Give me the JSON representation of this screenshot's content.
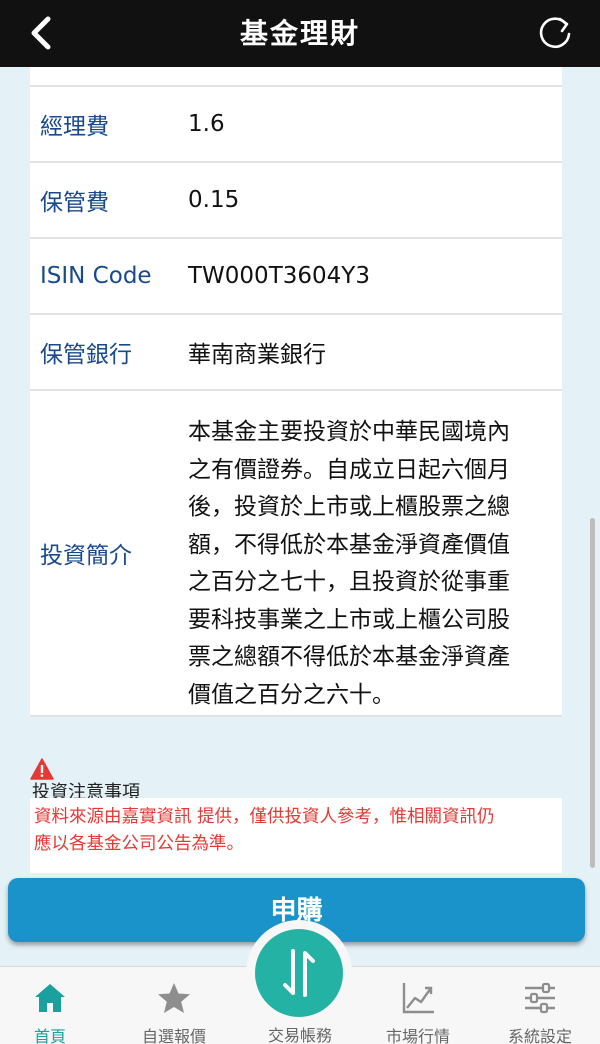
{
  "header": {
    "title": "基金理財"
  },
  "fund_info": [
    {
      "label": "經理費",
      "value": "1.6"
    },
    {
      "label": "保管費",
      "value": "0.15"
    },
    {
      "label": "ISIN Code",
      "value": "TW000T3604Y3"
    },
    {
      "label": "保管銀行",
      "value": "華南商業銀行"
    }
  ],
  "description": {
    "label": "投資簡介",
    "lines": [
      "本基金主要投資於中華民國境內",
      "之有價證券。自成立日起六個月",
      "後，投資於上市或上櫃股票之總",
      "額，不得低於本基金淨資產價值",
      "之百分之七十，且投資於從事重",
      "要科技事業之上市或上櫃公司股",
      "票之總額不得低於本基金淨資產",
      "價值之百分之六十。"
    ]
  },
  "notice": {
    "title": "投資注意事項",
    "line1": "資料來源由嘉實資訊 提供，僅供投資人參考，惟相關資訊仍",
    "line2": "應以各基金公司公告為準。"
  },
  "actions": {
    "subscribe_label": "申購"
  },
  "tabbar": {
    "home": "首頁",
    "watchlist": "自選報價",
    "trade": "交易帳務",
    "market": "市場行情",
    "settings": "系統設定"
  },
  "colors": {
    "header_bg": "#111111",
    "label_blue": "#1a4a8c",
    "notice_red": "#e53935",
    "button_blue": "#1993c9",
    "accent_teal": "#1aa19e"
  }
}
